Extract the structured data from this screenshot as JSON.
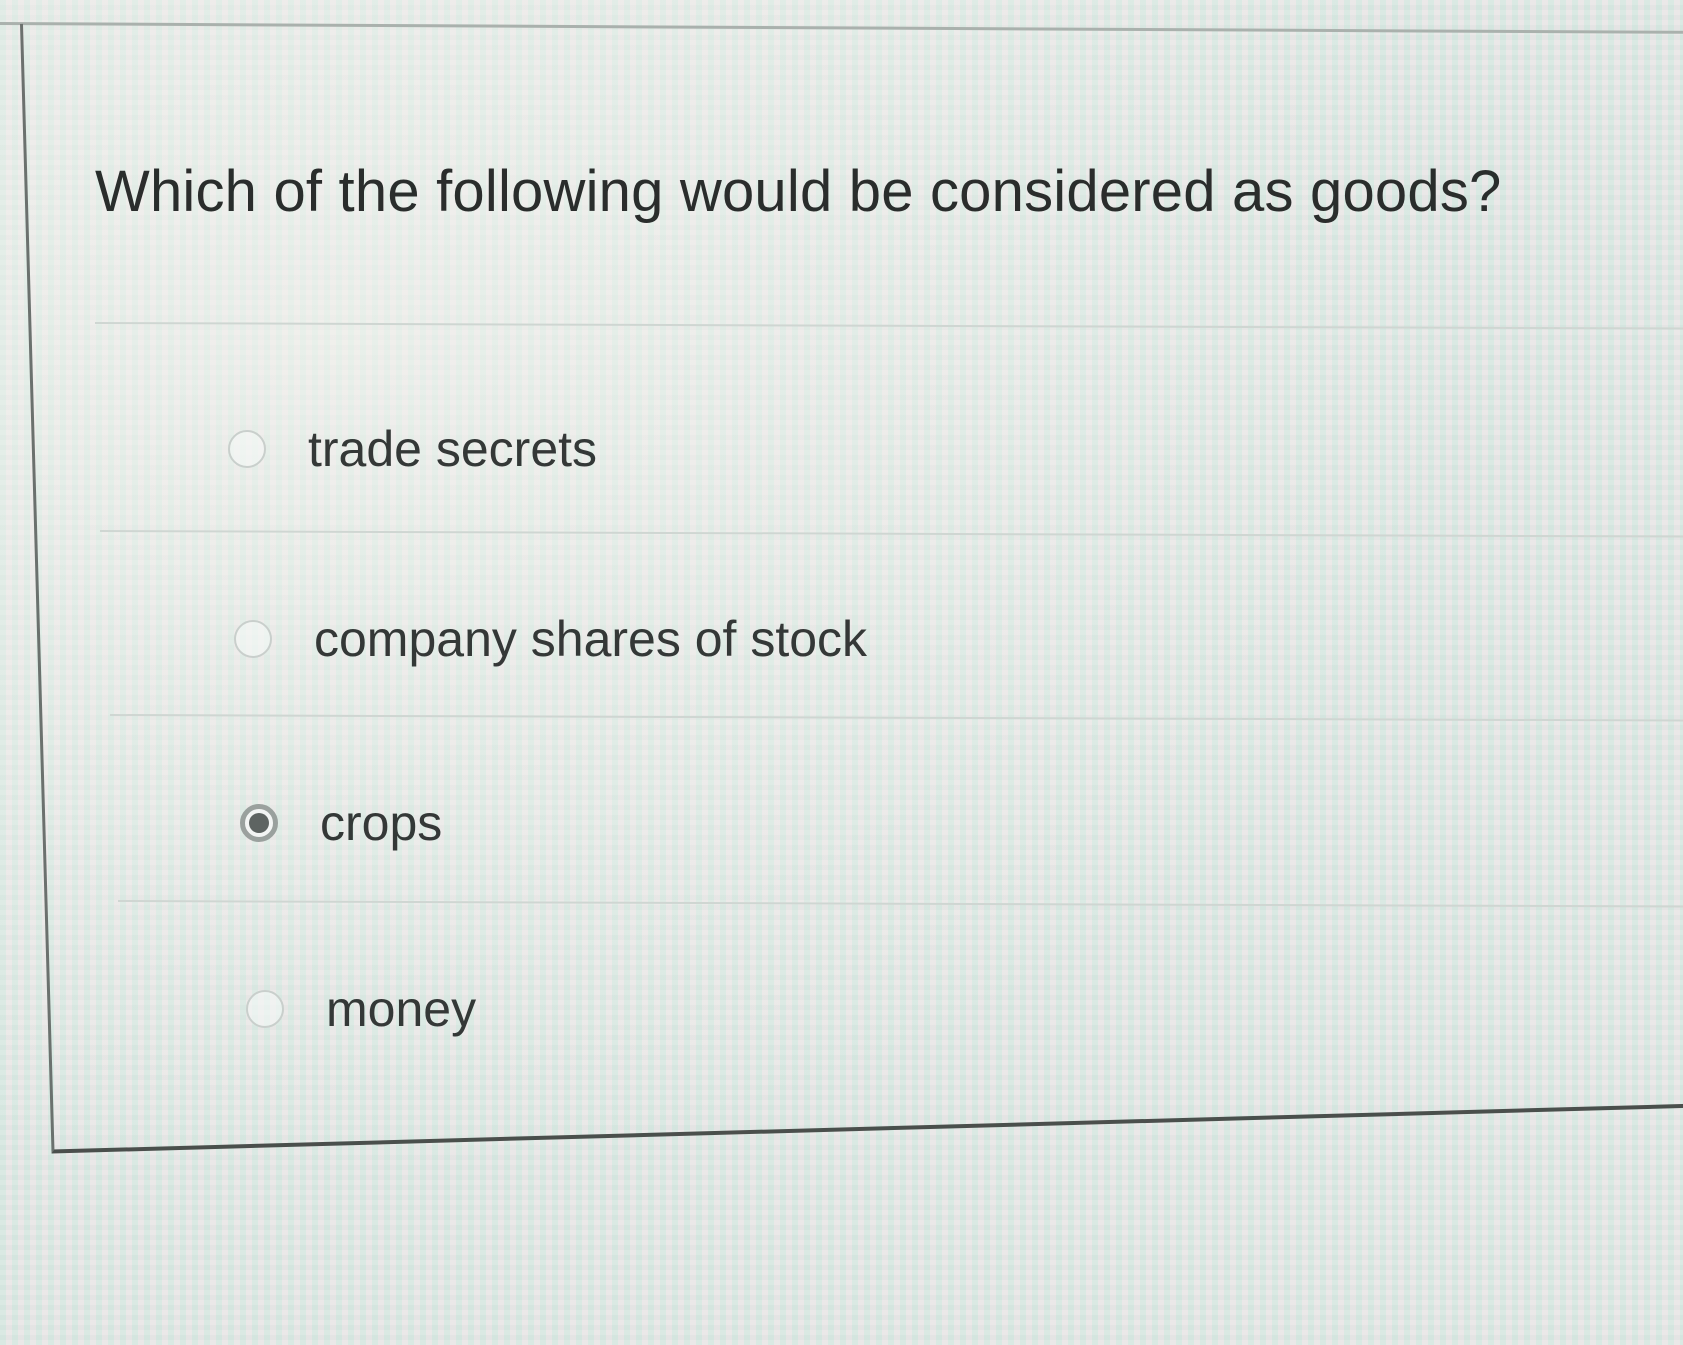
{
  "question": {
    "text": "Which of the following would be considered as goods?"
  },
  "options": [
    {
      "label": "trade secrets",
      "selected": false
    },
    {
      "label": "company shares of stock",
      "selected": false
    },
    {
      "label": "crops",
      "selected": true
    },
    {
      "label": "money",
      "selected": false
    }
  ],
  "colors": {
    "background": "#e6ebe8",
    "text": "#2a2d2c",
    "radio_border": "#c9cfcc",
    "radio_selected": "#5e6462"
  }
}
